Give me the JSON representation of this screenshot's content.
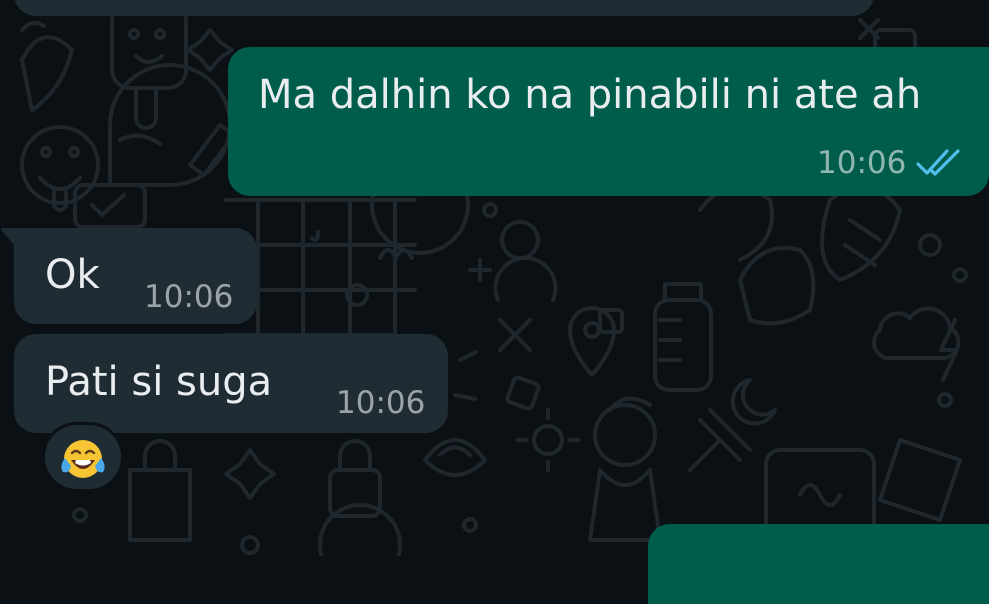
{
  "conversation": {
    "messages": [
      {
        "direction": "outgoing",
        "text": "Ma dalhin ko na pinabili ni ate ah",
        "time": "10:06",
        "status_icon": "double-check-read-icon"
      },
      {
        "direction": "incoming",
        "text": "Ok",
        "time": "10:06"
      },
      {
        "direction": "incoming",
        "text": "Pati si suga",
        "time": "10:06",
        "reaction_icon": "face-with-tears-of-joy-icon"
      }
    ]
  },
  "theme": {
    "background": "#0b1014",
    "outgoing_bubble": "#005c4b",
    "incoming_bubble": "#202c33",
    "text": "#e9edef",
    "read_tick": "#53bdeb"
  }
}
